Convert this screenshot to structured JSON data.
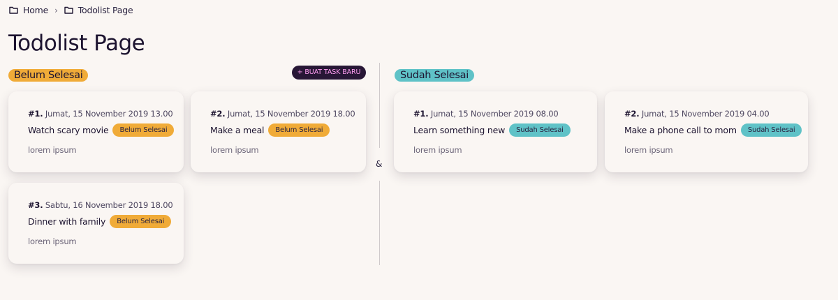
{
  "breadcrumb": {
    "items": [
      {
        "label": "Home",
        "icon": "folder-icon"
      },
      {
        "label": "Todolist Page",
        "icon": "folder-icon"
      }
    ],
    "separator_icon": "chevron-right-icon"
  },
  "page": {
    "title": "Todolist Page"
  },
  "belum": {
    "label": "Belum Selesai",
    "color": "#f0ab38",
    "new_task_button": "+ BUAT TASK BARU",
    "cards": [
      {
        "num": "#1.",
        "date": "Jumat, 15 November 2019 13.00",
        "title": "Watch scary movie",
        "badge": "Belum Selesai",
        "desc": "lorem ipsum"
      },
      {
        "num": "#2.",
        "date": "Jumat, 15 November 2019 18.00",
        "title": "Make a meal",
        "badge": "Belum Selesai",
        "desc": "lorem ipsum"
      },
      {
        "num": "#3.",
        "date": "Sabtu, 16 November 2019 18.00",
        "title": "Dinner with family",
        "badge": "Belum Selesai",
        "desc": "lorem ipsum"
      }
    ]
  },
  "divider": {
    "symbol": "&"
  },
  "sudah": {
    "label": "Sudah Selesai",
    "color": "#5fc2c7",
    "cards": [
      {
        "num": "#1.",
        "date": "Jumat, 15 November 2019 08.00",
        "title": "Learn something new",
        "badge": "Sudah Selesai",
        "desc": "lorem ipsum"
      },
      {
        "num": "#2.",
        "date": "Jumat, 15 November 2019 04.00",
        "title": "Make a phone call to mom",
        "badge": "Sudah Selesai",
        "desc": "lorem ipsum"
      }
    ]
  }
}
